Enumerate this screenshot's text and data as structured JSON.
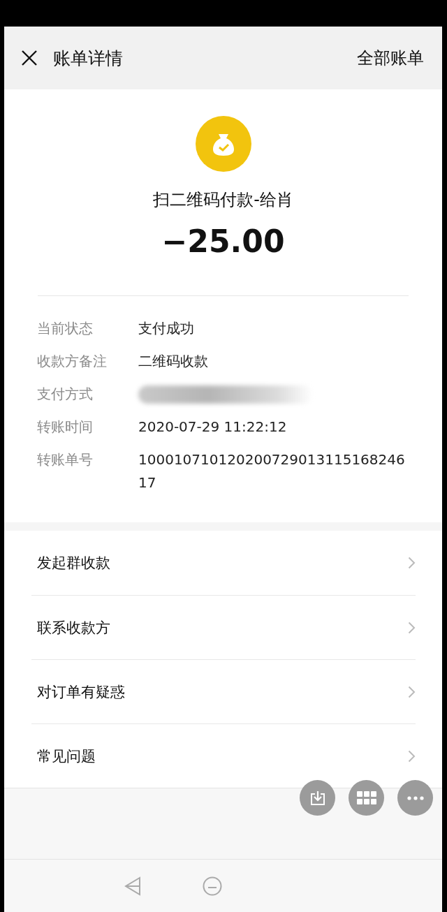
{
  "header": {
    "title": "账单详情",
    "action": "全部账单"
  },
  "summary": {
    "title": "扫二维码付款-给肖",
    "amount": "−25.00"
  },
  "details": [
    {
      "label": "当前状态",
      "value": "支付成功",
      "kind": "text"
    },
    {
      "label": "收款方备注",
      "value": "二维码收款",
      "kind": "text"
    },
    {
      "label": "支付方式",
      "kind": "blurred"
    },
    {
      "label": "转账时间",
      "value": "2020-07-29 11:22:12",
      "kind": "text"
    },
    {
      "label": "转账单号",
      "value": "10001071012020072901311516824617",
      "kind": "text"
    }
  ],
  "menu": [
    "发起群收款",
    "联系收款方",
    "对订单有疑惑",
    "常见问题"
  ]
}
